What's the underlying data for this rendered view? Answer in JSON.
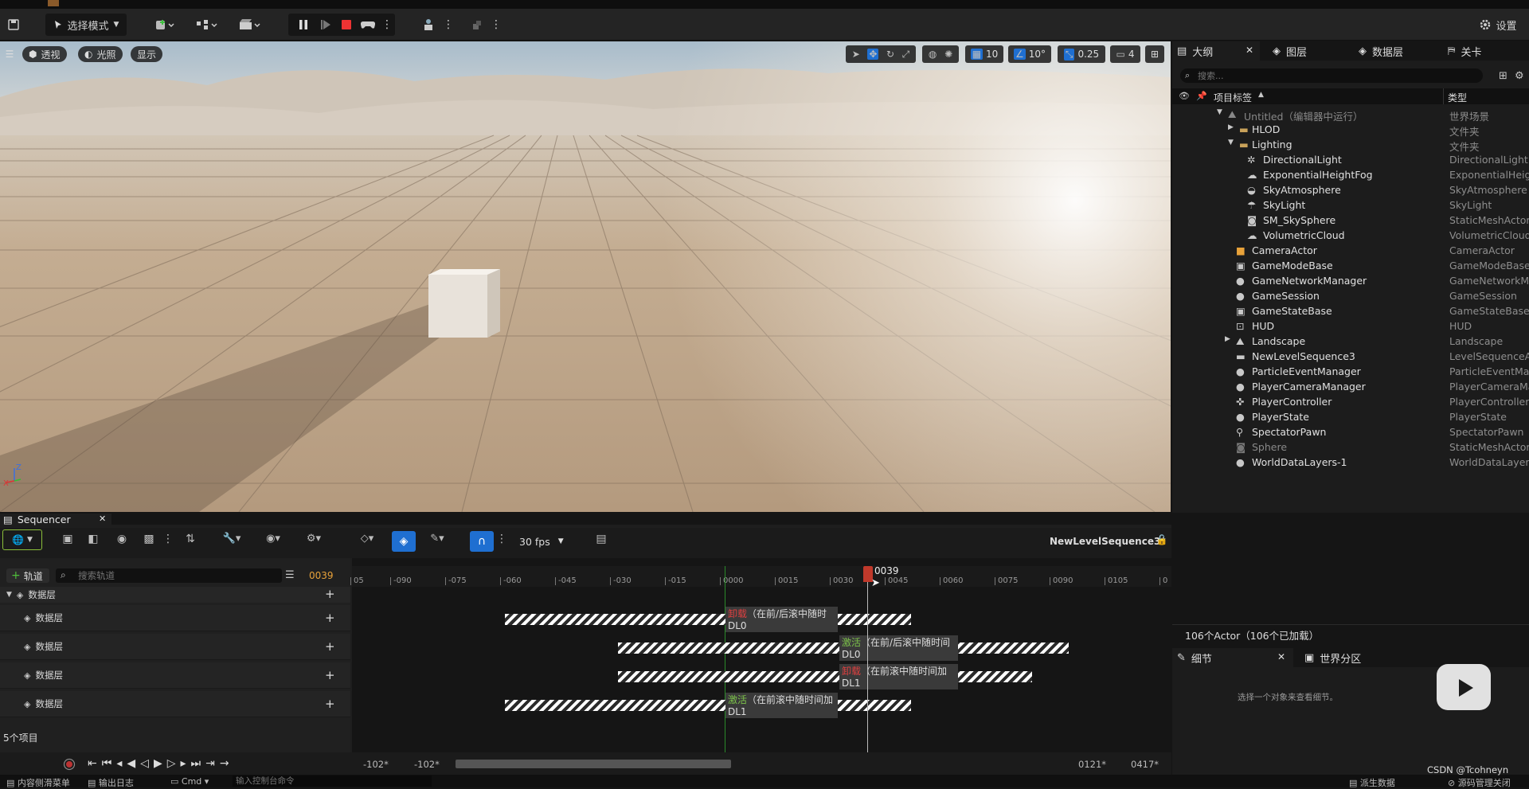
{
  "toolbar": {
    "mode_label": "选择模式",
    "settings_label": "设置"
  },
  "viewport": {
    "perspective_label": "透视",
    "lighting_label": "光照",
    "show_label": "显示",
    "grid_value": "10",
    "angle_value": "10°",
    "scale_value": "0.25",
    "camera_speed": "4",
    "axis_z": "Z",
    "axis_x": "X"
  },
  "outliner": {
    "tabs": [
      "大纲",
      "图层",
      "数据层",
      "关卡"
    ],
    "search_placeholder": "搜索...",
    "col_label": "项目标签",
    "col_type": "类型",
    "rows": [
      {
        "name": "Untitled（编辑器中运行）",
        "type": "世界场景",
        "dim": true
      },
      {
        "name": "HLOD",
        "type": "文件夹"
      },
      {
        "name": "Lighting",
        "type": "文件夹"
      },
      {
        "name": "DirectionalLight",
        "type": "DirectionalLight"
      },
      {
        "name": "ExponentialHeightFog",
        "type": "ExponentialHeigh"
      },
      {
        "name": "SkyAtmosphere",
        "type": "SkyAtmosphere"
      },
      {
        "name": "SkyLight",
        "type": "SkyLight"
      },
      {
        "name": "SM_SkySphere",
        "type": "StaticMeshActor"
      },
      {
        "name": "VolumetricCloud",
        "type": "VolumetricCloud"
      },
      {
        "name": "CameraActor",
        "type": "CameraActor"
      },
      {
        "name": "GameModeBase",
        "type": "GameModeBase"
      },
      {
        "name": "GameNetworkManager",
        "type": "GameNetworkMa"
      },
      {
        "name": "GameSession",
        "type": "GameSession"
      },
      {
        "name": "GameStateBase",
        "type": "GameStateBase"
      },
      {
        "name": "HUD",
        "type": "HUD"
      },
      {
        "name": "Landscape",
        "type": "Landscape"
      },
      {
        "name": "NewLevelSequence3",
        "type": "LevelSequenceAc"
      },
      {
        "name": "ParticleEventManager",
        "type": "ParticleEventMan"
      },
      {
        "name": "PlayerCameraManager",
        "type": "PlayerCameraMa"
      },
      {
        "name": "PlayerController",
        "type": "PlayerController"
      },
      {
        "name": "PlayerState",
        "type": "PlayerState"
      },
      {
        "name": "SpectatorPawn",
        "type": "SpectatorPawn"
      },
      {
        "name": "Sphere",
        "type": "StaticMeshActor",
        "dim": true
      },
      {
        "name": "WorldDataLayers-1",
        "type": "WorldDataLayers"
      }
    ],
    "actor_count": "106个Actor（106个已加载）"
  },
  "details": {
    "tab_details": "细节",
    "tab_world_partition": "世界分区",
    "empty_hint": "选择一个对象来查看细节。"
  },
  "sequencer": {
    "tab_label": "Sequencer",
    "fps_label": "30 fps",
    "sequence_name": "NewLevelSequence3*",
    "add_track_label": "轨道",
    "search_placeholder": "搜索轨道",
    "current_frame": "0039",
    "playhead_label": "0039",
    "group_label": "数据层",
    "tracks": [
      "数据层",
      "数据层",
      "数据层",
      "数据层"
    ],
    "item_count": "5个项目",
    "ticks": [
      "05",
      "-090",
      "-075",
      "-060",
      "-045",
      "-030",
      "-015",
      "0000",
      "0015",
      "0030",
      "0045",
      "0060",
      "0075",
      "0090",
      "0105",
      "0"
    ],
    "sections": [
      {
        "action": "卸载",
        "action_color": "#e04040",
        "text": "（在前/后滚中随时",
        "layer": "DL0"
      },
      {
        "action": "激活",
        "action_color": "#7cc24a",
        "text": "（在前/后滚中随时间",
        "layer": "DL0"
      },
      {
        "action": "卸载",
        "action_color": "#e04040",
        "text": "（在前滚中随时间加",
        "layer": "DL1"
      },
      {
        "action": "激活",
        "action_color": "#7cc24a",
        "text": "（在前滚中随时间加",
        "layer": "DL1"
      }
    ],
    "range_start_1": "-102*",
    "range_start_2": "-102*",
    "range_end_1": "0121*",
    "range_end_2": "0417*"
  },
  "statusbar": {
    "content_drawer": "内容侧滑菜单",
    "output_log": "输出日志",
    "cmd_label": "Cmd",
    "cmd_placeholder": "输入控制台命令",
    "derived_data": "派生数据",
    "source_control": "源码管理关闭",
    "watermark": "CSDN @Tcohneyn"
  }
}
